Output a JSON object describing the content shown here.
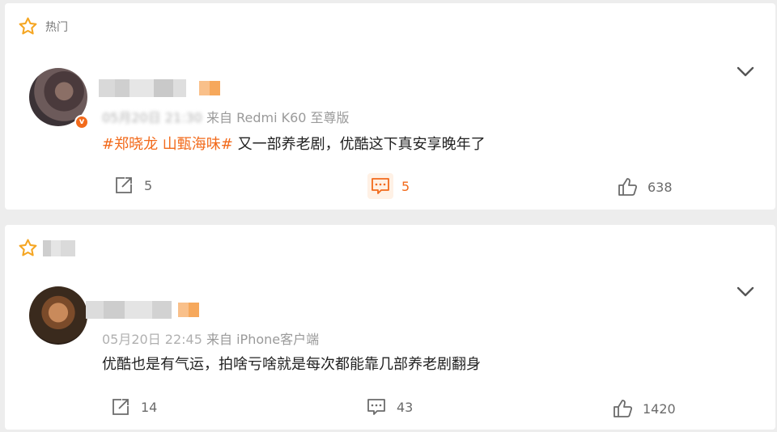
{
  "sections": {
    "hot_label": "热门"
  },
  "comments": [
    {
      "meta_source": "来自 Redmi K60 至尊版",
      "time_visible": "05月20日 21:30",
      "topic": "#郑晓龙 山甄海味#",
      "text": " 又一部养老剧，优酷这下真安享晚年了",
      "actions": {
        "repost": "5",
        "comment": "5",
        "like": "638"
      }
    },
    {
      "meta_source": "来自 iPhone客户端",
      "time_visible": "05月20日 22:45",
      "topic": "",
      "text": "优酷也是有气运，拍啥亏啥就是每次都能靠几部养老剧翻身",
      "actions": {
        "repost": "14",
        "comment": "43",
        "like": "1420"
      }
    }
  ],
  "colors": {
    "accent": "#f26a1b",
    "star": "#f5a623"
  },
  "icons": [
    "star-icon",
    "chevron-down-icon",
    "repost-icon",
    "comment-icon",
    "like-icon",
    "verified-badge-icon"
  ]
}
